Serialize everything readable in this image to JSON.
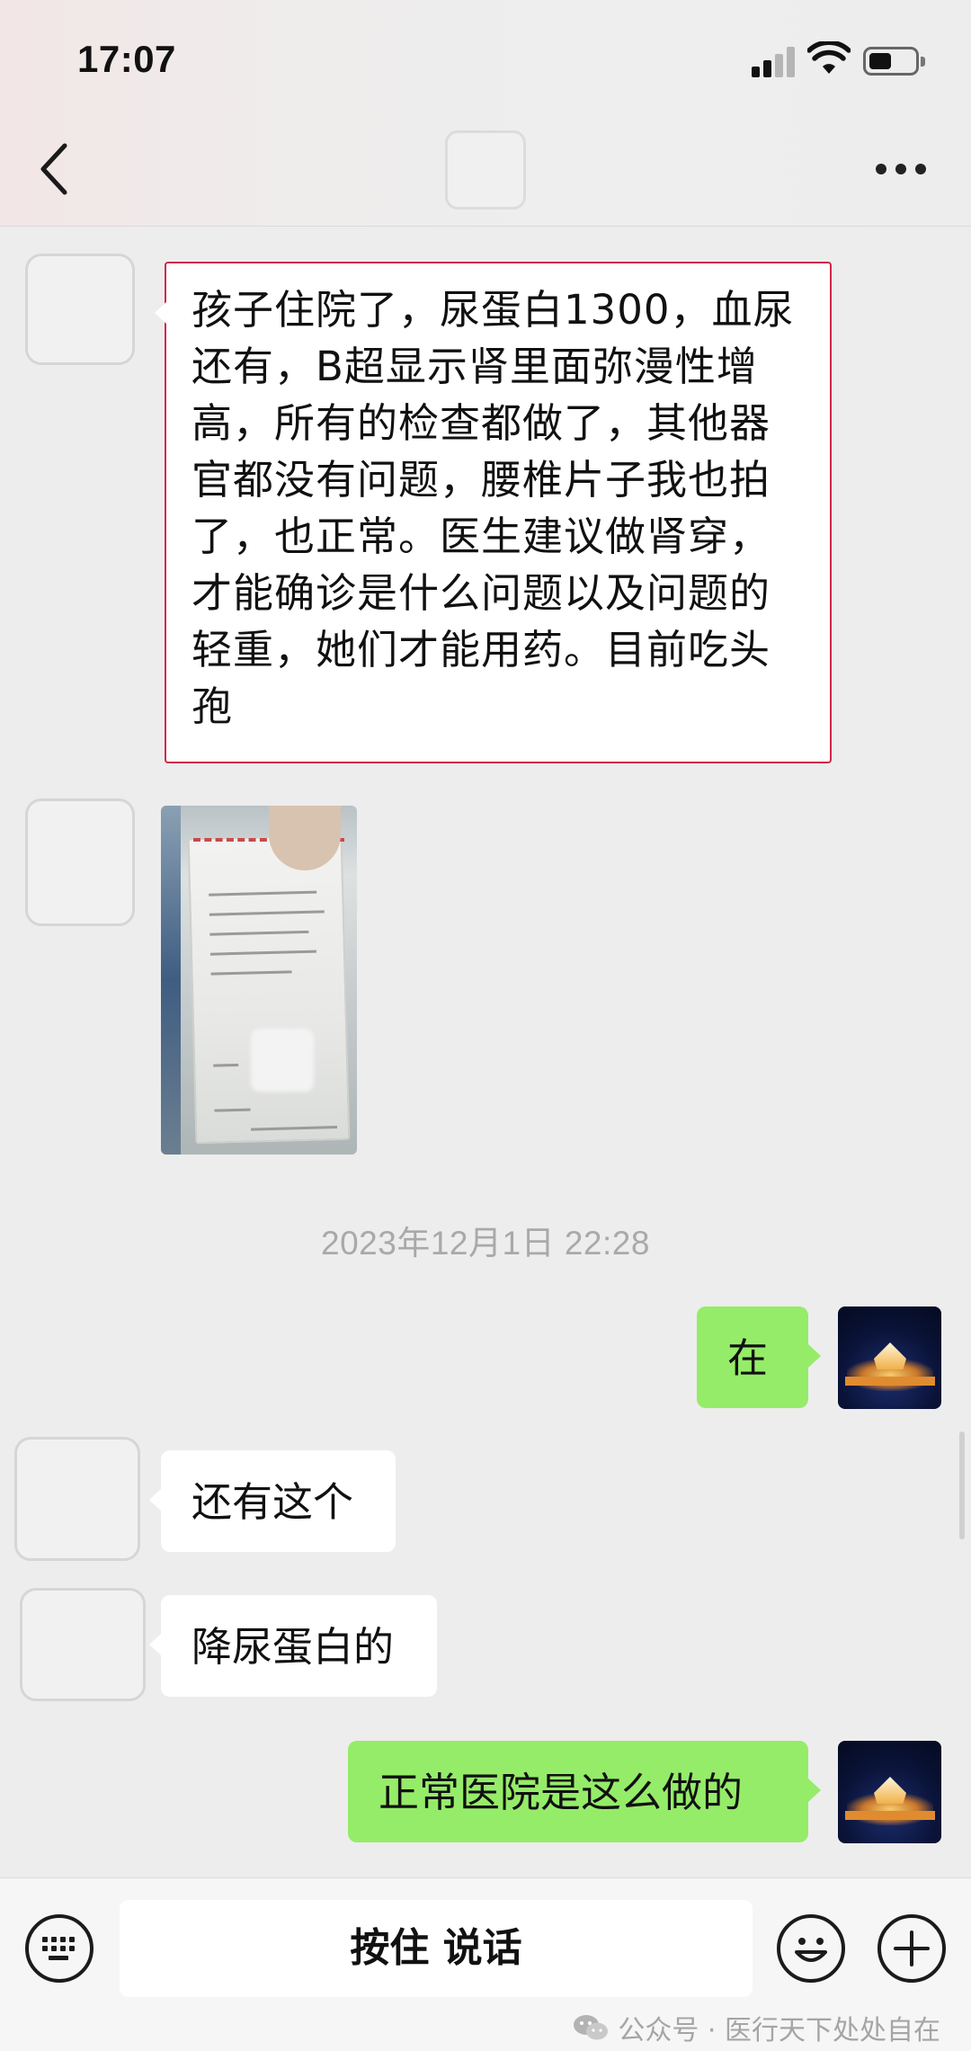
{
  "status_bar": {
    "time": "17:07"
  },
  "header": {
    "back_icon": "chevron-left-icon",
    "more_icon": "ellipsis-icon"
  },
  "messages": [
    {
      "side": "left",
      "type": "text",
      "text": "孩子住院了，尿蛋白1300，血尿还有，B超显示肾里面弥漫性增高，所有的检查都做了，其他器官都没有问题，腰椎片子我也拍了，也正常。医生建议做肾穿，才能确诊是什么问题以及问题的轻重，她们才能用药。目前吃头孢"
    },
    {
      "side": "left",
      "type": "image",
      "description": "medicine packet photo"
    },
    {
      "side": "right",
      "type": "text",
      "text": "在"
    },
    {
      "side": "left",
      "type": "text",
      "text": "还有这个"
    },
    {
      "side": "left",
      "type": "text",
      "text": "降尿蛋白的"
    },
    {
      "side": "right",
      "type": "text",
      "text": "正常医院是这么做的"
    }
  ],
  "timestamp": "2023年12月1日 22:28",
  "input_bar": {
    "keyboard_icon": "keyboard-icon",
    "hold_to_talk": "按住 说话",
    "emoji_icon": "emoji-icon",
    "plus_icon": "plus-icon"
  },
  "watermark": "公众号 · 医行天下处处自在",
  "colors": {
    "self_bubble": "#95ec69",
    "other_bubble": "#ffffff",
    "background": "#ededed"
  }
}
